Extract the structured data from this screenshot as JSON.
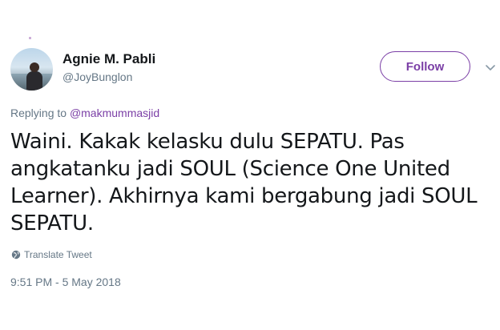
{
  "user": {
    "display_name": "Agnie M. Pabli",
    "handle": "@JoyBunglon",
    "avatar_icon": "user-avatar-photo"
  },
  "actions": {
    "follow_label": "Follow",
    "menu_icon": "chevron-down-icon"
  },
  "reply": {
    "prefix": "Replying to ",
    "mention": "@makmummasjid"
  },
  "tweet": {
    "text": "Waini. Kakak kelasku dulu SEPATU. Pas angkatanku jadi SOUL (Science One United Learner). Akhirnya kami bergabung jadi SOUL SEPATU.",
    "translate_label": "Translate Tweet",
    "timestamp": "9:51 PM - 5 May 2018"
  },
  "colors": {
    "accent": "#7b3fa6",
    "secondary_text": "#657786",
    "primary_text": "#14171a"
  }
}
